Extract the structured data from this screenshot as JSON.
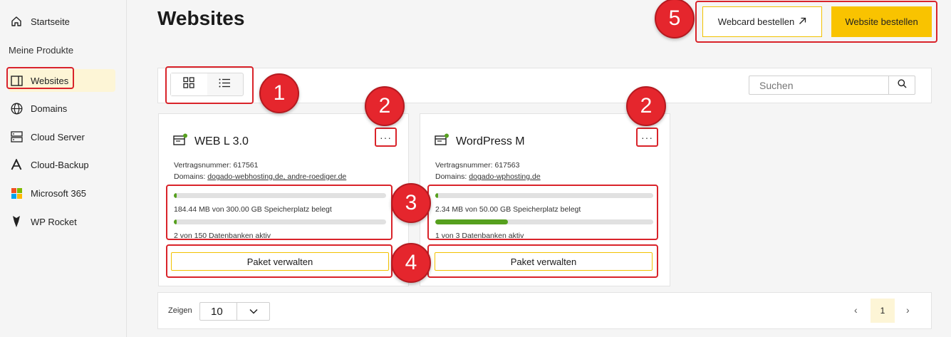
{
  "sidebar": {
    "home": "Startseite",
    "section_title": "Meine Produkte",
    "items": [
      {
        "label": "Websites",
        "icon": "layout-sidebar-icon",
        "active": true
      },
      {
        "label": "Domains",
        "icon": "globe-icon"
      },
      {
        "label": "Cloud Server",
        "icon": "server-icon"
      },
      {
        "label": "Cloud-Backup",
        "icon": "acronis-icon"
      },
      {
        "label": "Microsoft 365",
        "icon": "microsoft-logo-icon"
      },
      {
        "label": "WP Rocket",
        "icon": "rocket-icon"
      }
    ]
  },
  "header": {
    "title": "Websites",
    "webcard_button": "Webcard bestellen",
    "website_button": "Website bestellen"
  },
  "toolbar": {
    "search_placeholder": "Suchen"
  },
  "cards": [
    {
      "title": "WEB L 3.0",
      "contract_label": "Vertragsnummer: 617561",
      "domains_label": "Domains:",
      "domains_value": "dogado-webhosting.de, andre-roediger.de",
      "storage_text": "184.44 MB von 300.00 GB Speicherplatz belegt",
      "storage_fraction": 0.0006,
      "db_text": "2 von 150 Datenbanken aktiv",
      "db_fraction": 0.013,
      "manage_button": "Paket verwalten",
      "more_label": "···"
    },
    {
      "title": "WordPress M",
      "contract_label": "Vertragsnummer: 617563",
      "domains_label": "Domains:",
      "domains_value": "dogado-wphosting.de",
      "storage_text": "2.34 MB von 50.00 GB Speicherplatz belegt",
      "storage_fraction": 5e-05,
      "db_text": "1 von 3 Datenbanken aktiv",
      "db_fraction": 0.333,
      "manage_button": "Paket verwalten",
      "more_label": "···"
    }
  ],
  "badges": [
    "1",
    "2",
    "2",
    "3",
    "4",
    "5"
  ],
  "footer": {
    "show_label": "Zeigen",
    "page_size": "10",
    "current_page": "1",
    "prev": "‹",
    "next": "›"
  },
  "colors": {
    "accent": "#f9c300",
    "highlight": "#d9232a",
    "progress": "#56a01e",
    "active_nav": "#fdf5d6"
  }
}
